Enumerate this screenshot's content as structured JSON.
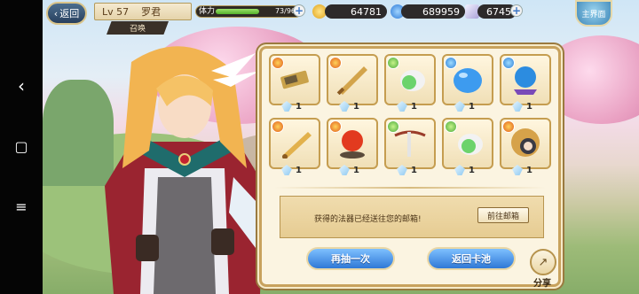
{
  "system_nav": {
    "back_glyph": "‹",
    "home_glyph": "▢",
    "menu_glyph": "≡"
  },
  "topbar": {
    "back_label": "返回",
    "level_label": "Lv 57",
    "player_name": "罗君",
    "summon_tag": "召唤",
    "stamina_label": "体力",
    "stamina_value": "73/96",
    "stamina_fraction": 0.76,
    "gold": "64781",
    "diamonds": "689959",
    "crystals": "6745",
    "main_button": "主界面"
  },
  "colors": {
    "gold": "#f0b62a",
    "diamond": "#3f8fe6",
    "crystal": "#d9d4ef",
    "accent_blue": "#2f78d6",
    "panel_border": "#c8a25d"
  },
  "rewards": [
    {
      "name": "gold-bar-item",
      "element": "fire",
      "count": "1"
    },
    {
      "name": "bronze-sword-item",
      "element": "fire",
      "count": "1"
    },
    {
      "name": "green-spirit-item",
      "element": "wind",
      "count": "1"
    },
    {
      "name": "blue-flask-item",
      "element": "water",
      "count": "1"
    },
    {
      "name": "blue-orb-item",
      "element": "water",
      "count": "1"
    },
    {
      "name": "golden-sword-item",
      "element": "fire",
      "count": "1"
    },
    {
      "name": "red-orb-item",
      "element": "fire",
      "count": "1"
    },
    {
      "name": "crossbow-item",
      "element": "wind",
      "count": "1"
    },
    {
      "name": "green-spirit-item-2",
      "element": "wind",
      "count": "1"
    },
    {
      "name": "character-portrait-item",
      "element": "fire",
      "count": "1"
    }
  ],
  "notice": {
    "text": "获得的法器已经送往您的邮箱!",
    "mail_button": "前往邮箱"
  },
  "actions": {
    "draw_again": "再抽一次",
    "back_to_pool": "返回卡池",
    "share": "分享"
  }
}
